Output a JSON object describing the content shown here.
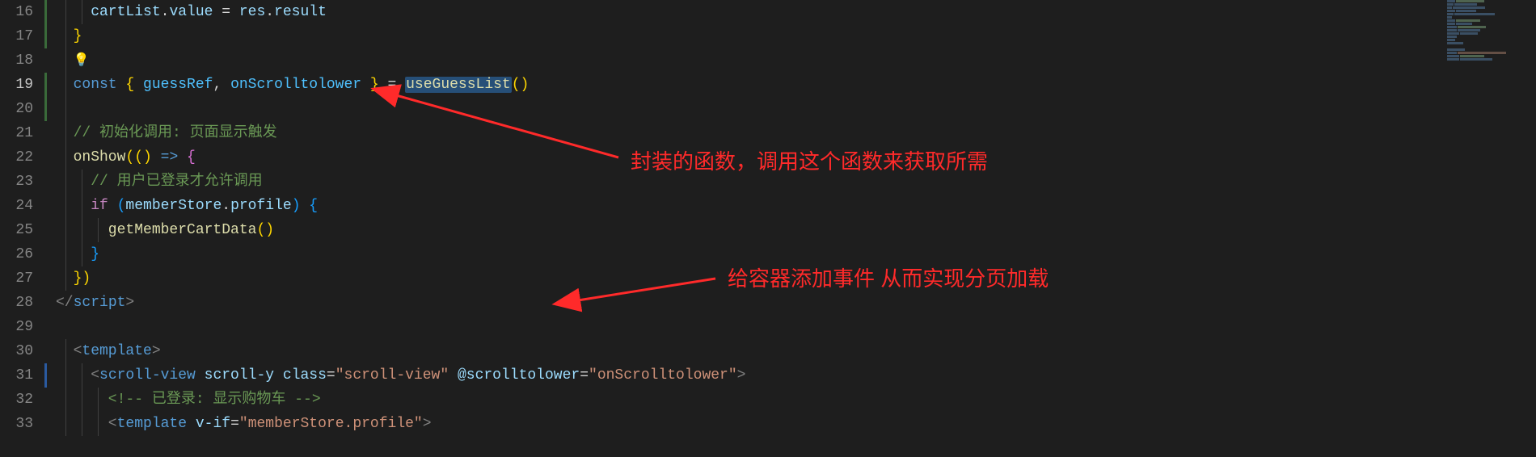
{
  "lines": {
    "start": 16,
    "active": 19,
    "numbers": [
      "16",
      "17",
      "18",
      "19",
      "20",
      "21",
      "22",
      "23",
      "24",
      "25",
      "26",
      "27",
      "28",
      "29",
      "30",
      "31",
      "32",
      "33"
    ]
  },
  "code": {
    "l16_a": "    cartList",
    "l16_b": ".",
    "l16_c": "value",
    "l16_d": " = ",
    "l16_e": "res",
    "l16_f": ".",
    "l16_g": "result",
    "l17": "  }",
    "l19_const": "  const",
    "l19_open": " { ",
    "l19_g": "guessRef",
    "l19_c": ", ",
    "l19_o": "onScrolltolower",
    "l19_close": " } ",
    "l19_eq": "= ",
    "l19_fn": "useGuessList",
    "l19_p": "()",
    "l21_cmt": "  // 初始化调用: 页面显示触发",
    "l22_a": "  onShow",
    "l22_b": "(() ",
    "l22_c": "=>",
    "l22_d": " {",
    "l23_cmt": "    // 用户已登录才允许调用",
    "l24_if": "    if",
    "l24_o": " (",
    "l24_m": "memberStore",
    "l24_d": ".",
    "l24_p": "profile",
    "l24_c": ") {",
    "l25_fn": "      getMemberCartData",
    "l25_p": "()",
    "l26": "    }",
    "l27": "  })",
    "l28_a": "</",
    "l28_b": "script",
    "l28_c": ">",
    "l30_a": "  <",
    "l30_b": "template",
    "l30_c": ">",
    "l31_a": "    <",
    "l31_b": "scroll-view",
    "l31_sp1": " ",
    "l31_sy": "scroll-y",
    "l31_sp2": " ",
    "l31_cls": "class",
    "l31_eq1": "=",
    "l31_v1": "\"scroll-view\"",
    "l31_sp3": " ",
    "l31_at": "@scrolltolower",
    "l31_eq2": "=",
    "l31_v2": "\"onScrolltolower\"",
    "l31_c": ">",
    "l32_cmt": "      <!-- 已登录: 显示购物车 -->",
    "l33_a": "      <",
    "l33_b": "template",
    "l33_sp": " ",
    "l33_vif": "v-if",
    "l33_eq": "=",
    "l33_v": "\"memberStore.profile\"",
    "l33_c": ">"
  },
  "annotations": {
    "anno1": "封装的函数，调用这个函数来获取所需",
    "anno2": "给容器添加事件 从而实现分页加载"
  }
}
